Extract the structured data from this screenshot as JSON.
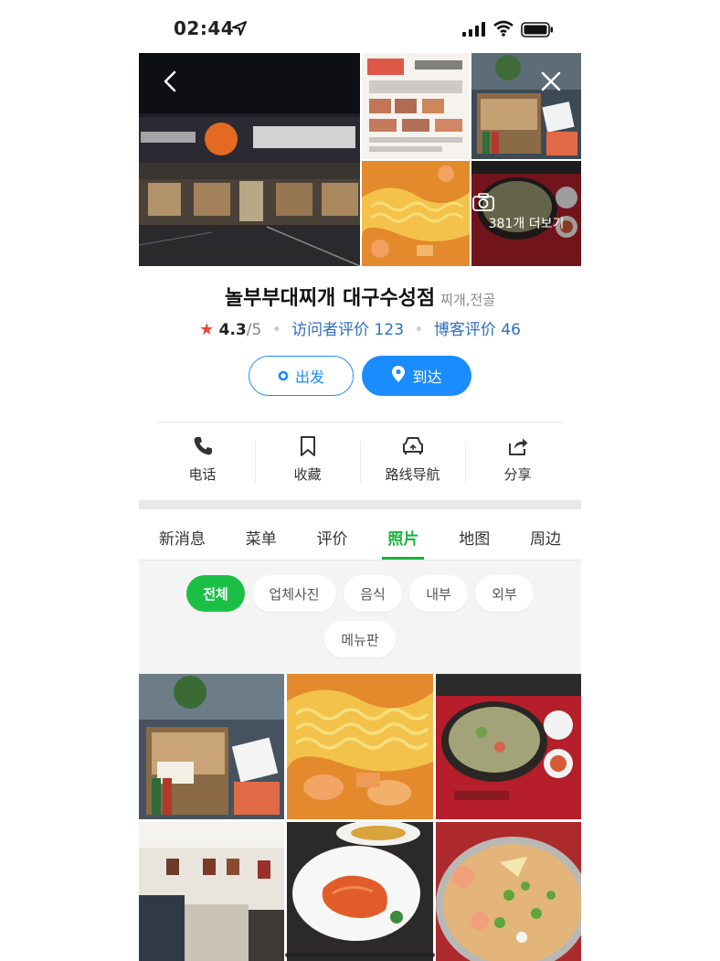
{
  "status_bar": {
    "time": "02:44"
  },
  "header": {
    "more_photos": "381개 더보기"
  },
  "place": {
    "name": "놀부부대찌개 대구수성점",
    "category": "찌개,전골",
    "rating": "4.3",
    "rating_max": "/5",
    "visitor_reviews": "访问者评价 123",
    "blog_reviews": "博客评价 46"
  },
  "buttons": {
    "depart": "出发",
    "arrive": "到达"
  },
  "actions": [
    {
      "label": "电话",
      "icon": "phone-icon"
    },
    {
      "label": "收藏",
      "icon": "bookmark-icon"
    },
    {
      "label": "路线导航",
      "icon": "car-route-icon"
    },
    {
      "label": "分享",
      "icon": "share-icon"
    }
  ],
  "tabs": [
    {
      "label": "新消息"
    },
    {
      "label": "菜单"
    },
    {
      "label": "评价"
    },
    {
      "label": "照片",
      "active": true
    },
    {
      "label": "地图"
    },
    {
      "label": "周边"
    }
  ],
  "chips": [
    {
      "label": "전체",
      "active": true
    },
    {
      "label": "업체사진"
    },
    {
      "label": "음식"
    },
    {
      "label": "내부"
    },
    {
      "label": "외부"
    },
    {
      "label": "메뉴판"
    }
  ],
  "colors": {
    "brand_blue": "#1a8cff",
    "green": "#1cbf45",
    "star": "#e8483b",
    "link": "#2f6ec2"
  }
}
